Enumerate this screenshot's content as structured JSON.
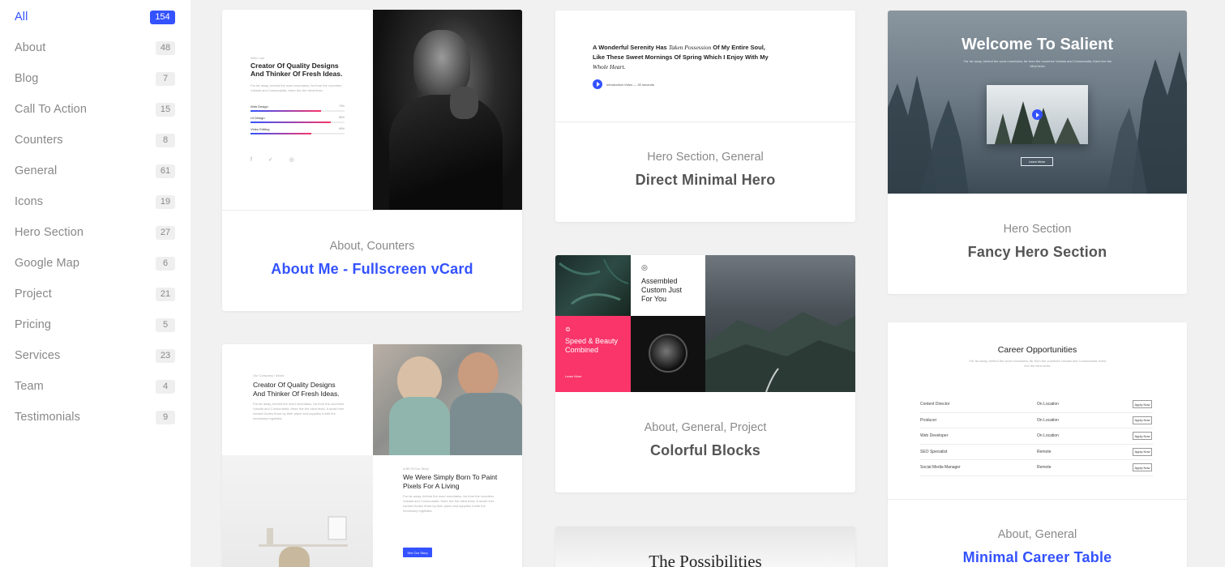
{
  "sidebar": {
    "categories": [
      {
        "label": "All",
        "count": "154"
      },
      {
        "label": "About",
        "count": "48"
      },
      {
        "label": "Blog",
        "count": "7"
      },
      {
        "label": "Call To Action",
        "count": "15"
      },
      {
        "label": "Counters",
        "count": "8"
      },
      {
        "label": "General",
        "count": "61"
      },
      {
        "label": "Icons",
        "count": "19"
      },
      {
        "label": "Hero Section",
        "count": "27"
      },
      {
        "label": "Google Map",
        "count": "6"
      },
      {
        "label": "Project",
        "count": "21"
      },
      {
        "label": "Pricing",
        "count": "5"
      },
      {
        "label": "Services",
        "count": "23"
      },
      {
        "label": "Team",
        "count": "4"
      },
      {
        "label": "Testimonials",
        "count": "9"
      }
    ]
  },
  "cards": {
    "about_me": {
      "categories": "About, Counters",
      "title": "About Me - Fullscreen vCard",
      "preview": {
        "heading": "Creator Of Quality Designs And Thinker Of Fresh Ideas.",
        "skills": [
          {
            "name": "Web Design",
            "percent": 75
          },
          {
            "name": "UI Design",
            "percent": 85
          },
          {
            "name": "Video Editing",
            "percent": 65
          }
        ]
      }
    },
    "direct_minimal": {
      "categories": "Hero Section, General",
      "title": "Direct Minimal Hero",
      "preview": {
        "quote_start": "A Wonderful Serenity Has ",
        "quote_italic1": "Taken Possession",
        "quote_mid": " Of My Entire Soul, Like These Sweet Mornings Of Spring Which I Enjoy With My ",
        "quote_italic2": "Whole Heart.",
        "video_label": "Introduction Video — 30 seconds"
      }
    },
    "fancy_hero": {
      "categories": "Hero Section",
      "title": "Fancy Hero Section",
      "preview": {
        "heading": "Welcome To Salient",
        "button": "Learn More"
      }
    },
    "colorful_blocks": {
      "categories": "About, General, Project",
      "title": "Colorful Blocks",
      "preview": {
        "assembled": "Assembled Custom Just For You",
        "speed": "Speed & Beauty Combined",
        "learn_more": "Learn More"
      }
    },
    "career_table": {
      "categories": "About, General",
      "title": "Minimal Career Table",
      "preview": {
        "heading": "Career Opportunities",
        "rows": [
          {
            "role": "Content Director",
            "location": "On Location",
            "action": "Apply Now"
          },
          {
            "role": "Producer",
            "location": "On Location",
            "action": "Apply Now"
          },
          {
            "role": "Web Developer",
            "location": "On Location",
            "action": "Apply Now"
          },
          {
            "role": "SEO Specialist",
            "location": "Remote",
            "action": "Apply Now"
          },
          {
            "role": "Social Media Manager",
            "location": "Remote",
            "action": "Apply Now"
          }
        ]
      }
    },
    "simply_born": {
      "preview": {
        "heading": "Creator Of Quality Designs And Thinker Of Fresh Ideas.",
        "heading2": "We Were Simply Born To Paint Pixels For A Living",
        "button": "See Our Story"
      }
    },
    "possibilities": {
      "preview": {
        "heading": "The Possibilities"
      }
    }
  },
  "colors": {
    "accent": "#3452ff",
    "pink": "#f9356a",
    "sidebar_bg": "#ffffff",
    "page_bg": "#f1f1f1"
  }
}
